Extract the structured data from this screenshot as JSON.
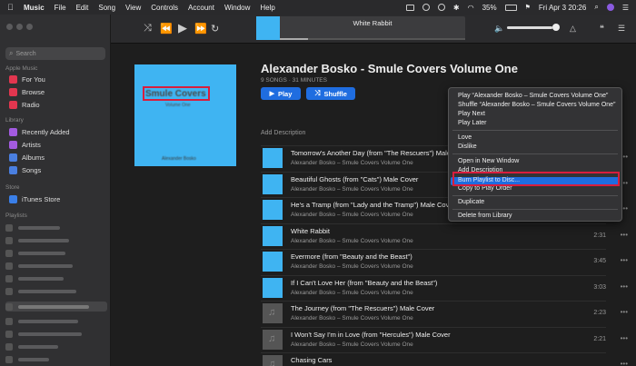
{
  "menubar": {
    "app_name": "Music",
    "menus": [
      "File",
      "Edit",
      "Song",
      "View",
      "Controls",
      "Account",
      "Window",
      "Help"
    ],
    "battery": "35%",
    "datetime": "Fri Apr 3  20:26"
  },
  "sidebar": {
    "search_placeholder": "Search",
    "apple_music_header": "Apple Music",
    "apple_music_items": [
      {
        "label": "For You",
        "color": "#e2364f"
      },
      {
        "label": "Browse",
        "color": "#e2364f"
      },
      {
        "label": "Radio",
        "color": "#e2364f"
      }
    ],
    "library_header": "Library",
    "library_items": [
      {
        "label": "Recently Added",
        "color": "#a35be0"
      },
      {
        "label": "Artists",
        "color": "#a35be0"
      },
      {
        "label": "Albums",
        "color": "#4a7fe0"
      },
      {
        "label": "Songs",
        "color": "#4a7fe0"
      }
    ],
    "store_header": "Store",
    "store_items": [
      {
        "label": "iTunes Store",
        "color": "#3a7fe8"
      }
    ],
    "playlists_header": "Playlists"
  },
  "toolbar": {
    "now_playing_title": "White Rabbit",
    "progress": 0.15,
    "volume": 0.86
  },
  "playlist": {
    "title": "Alexander Bosko - Smule Covers Volume One",
    "meta": "9 SONGS · 31 MINUTES",
    "play_label": "Play",
    "shuffle_label": "Shuffle",
    "add_description": "Add Description",
    "artwork_title": "Smule Covers",
    "artwork_subtitle": "Volume One",
    "artwork_footer": "Alexander Bosko"
  },
  "tracks": [
    {
      "title": "Tomorrow's Another Day (from \"The Rescuers\") Male Cover",
      "artist": "Alexander Bosko – Smule Covers Volume One",
      "time": "",
      "art": "blue"
    },
    {
      "title": "Beautiful Ghosts (from \"Cats\") Male Cover",
      "artist": "Alexander Bosko – Smule Covers Volume One",
      "time": "",
      "art": "blue"
    },
    {
      "title": "He's a Tramp (from \"Lady and the Tramp\") Male Cover",
      "artist": "Alexander Bosko – Smule Covers Volume One",
      "time": "",
      "art": "blue"
    },
    {
      "title": "White Rabbit",
      "artist": "Alexander Bosko – Smule Covers Volume One",
      "time": "2:31",
      "art": "blue"
    },
    {
      "title": "Evermore (from \"Beauty and the Beast\")",
      "artist": "Alexander Bosko – Smule Covers Volume One",
      "time": "3:45",
      "art": "blue"
    },
    {
      "title": "If I Can't Love Her (from \"Beauty and the Beast\")",
      "artist": "Alexander Bosko – Smule Covers Volume One",
      "time": "3:03",
      "art": "blue"
    },
    {
      "title": "The Journey (from \"The Rescuers\") Male Cover",
      "artist": "Alexander Bosko – Smule Covers Volume One",
      "time": "2:23",
      "art": "grey"
    },
    {
      "title": "I Won't Say I'm in Love (from \"Hercules\") Male Cover",
      "artist": "Alexander Bosko – Smule Covers Volume One",
      "time": "2:21",
      "art": "grey"
    },
    {
      "title": "Chasing Cars",
      "artist": "",
      "time": "",
      "art": "grey"
    }
  ],
  "context_menu": {
    "items": [
      "Play “Alexander Bosko – Smule Covers Volume One”",
      "Shuffle “Alexander Bosko – Smule Covers Volume One”",
      "Play Next",
      "Play Later",
      "Love",
      "Dislike",
      "Open in New Window",
      "Add Description",
      "Burn Playlist to Disc...",
      "Copy to Play Order",
      "Duplicate",
      "Delete from Library"
    ],
    "highlight_color": "#1f6de0",
    "annotation_color": "#d81e3d"
  }
}
